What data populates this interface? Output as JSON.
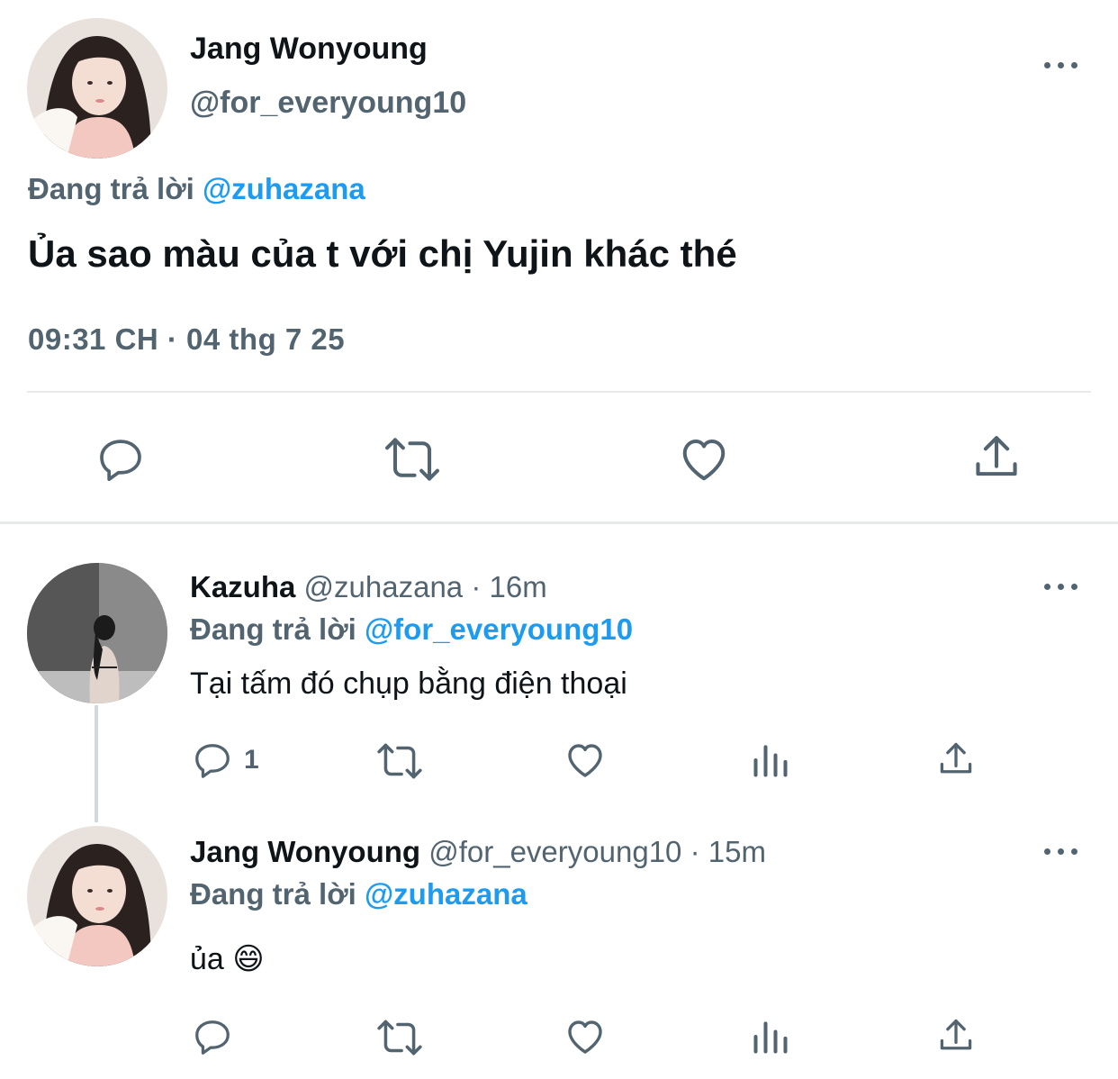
{
  "main_tweet": {
    "author_name": "Jang Wonyoung",
    "handle": "@for_everyoung10",
    "reply_prefix": "Đang trả lời",
    "reply_to": "@zuhazana",
    "text": "Ủa sao màu của t với chị Yujin khác thé",
    "timestamp": "09:31 CH · 04 thg 7 25",
    "actions": [
      "reply-icon",
      "retweet-icon",
      "like-icon",
      "share-icon"
    ]
  },
  "replies": [
    {
      "author_name": "Kazuha",
      "handle": "@zuhazana",
      "time": "· 16m",
      "reply_prefix": "Đang trả lời",
      "reply_to": "@for_everyoung10",
      "text": "Tại tấm đó chụp bằng điện thoại",
      "reply_count": "1"
    },
    {
      "author_name": "Jang Wonyoung",
      "handle": "@for_everyoung10",
      "time": "· 15m",
      "reply_prefix": "Đang trả lời",
      "reply_to": "@zuhazana",
      "text": "ủa 😄"
    }
  ],
  "colors": {
    "accent": "#1d9bf0",
    "text": "#0f1419",
    "muted": "#536471",
    "divider": "#e7e9ea"
  }
}
